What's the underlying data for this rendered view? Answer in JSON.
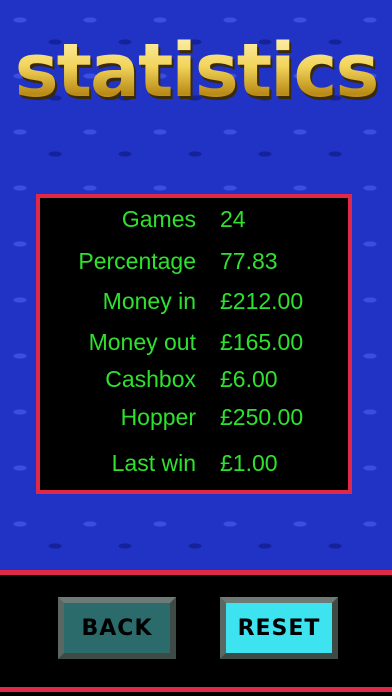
{
  "header": {
    "title": "statistics"
  },
  "stats": [
    {
      "label": "Games",
      "value": "24"
    },
    {
      "label": "Percentage",
      "value": "77.83"
    },
    {
      "label": "Money in",
      "value": "£212.00"
    },
    {
      "label": "Money out",
      "value": "£165.00"
    },
    {
      "label": "Cashbox",
      "value": "£6.00"
    },
    {
      "label": "Hopper",
      "value": "£250.00"
    },
    {
      "label": "Last win",
      "value": "£1.00"
    }
  ],
  "buttons": {
    "back_label": "BACK",
    "reset_label": "RESET"
  },
  "colors": {
    "background": "#1f2fb8",
    "accent_red": "#e0294a",
    "stat_text": "#2fe12f",
    "title_gold": "#e7c64a",
    "reset_button": "#3de3ee",
    "back_button": "#2b6b6c"
  }
}
